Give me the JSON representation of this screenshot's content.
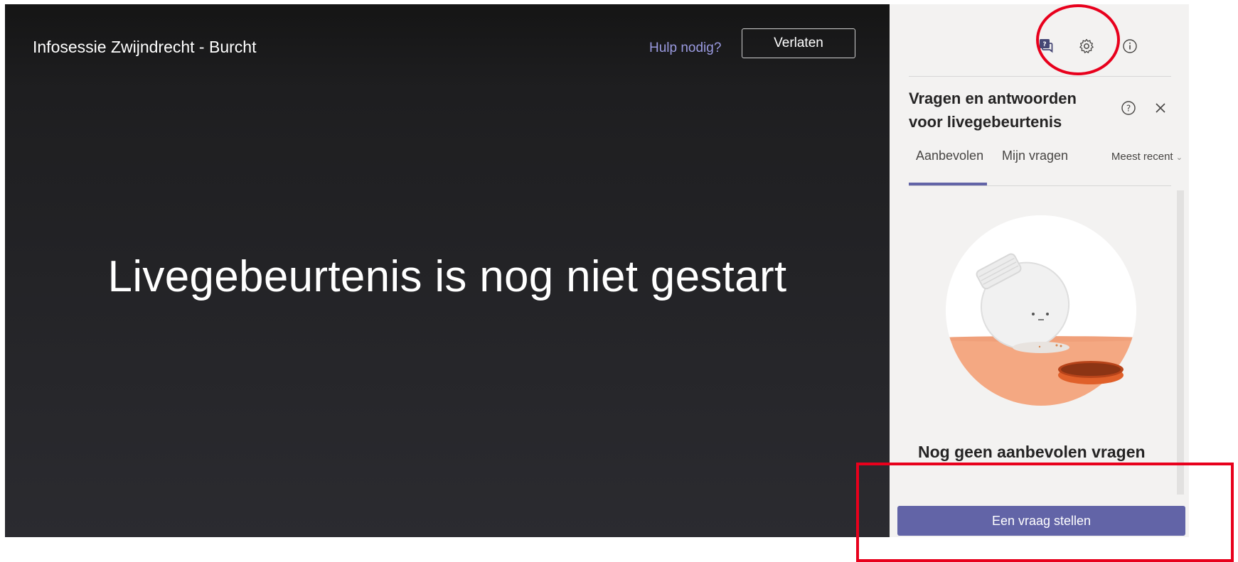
{
  "stage": {
    "event_title": "Infosessie Zwijndrecht - Burcht",
    "help_link": "Hulp nodig?",
    "leave_button": "Verlaten",
    "status_message": "Livegebeurtenis is nog niet gestart"
  },
  "panel": {
    "top_icons": [
      "qa-chat-icon",
      "settings-gear-icon",
      "info-icon"
    ],
    "title": "Vragen en antwoorden voor livegebeurtenis",
    "tabs": [
      {
        "label": "Aanbevolen",
        "active": true
      },
      {
        "label": "Mijn vragen",
        "active": false
      }
    ],
    "sort_label": "Meest recent",
    "empty_message": "Nog geen aanbevolen vragen",
    "ask_button": "Een vraag stellen"
  },
  "colors": {
    "accent": "#6264a7",
    "annotation": "#e8001c",
    "illustration_orange": "#f4a882",
    "lid_orange": "#e0602a"
  }
}
